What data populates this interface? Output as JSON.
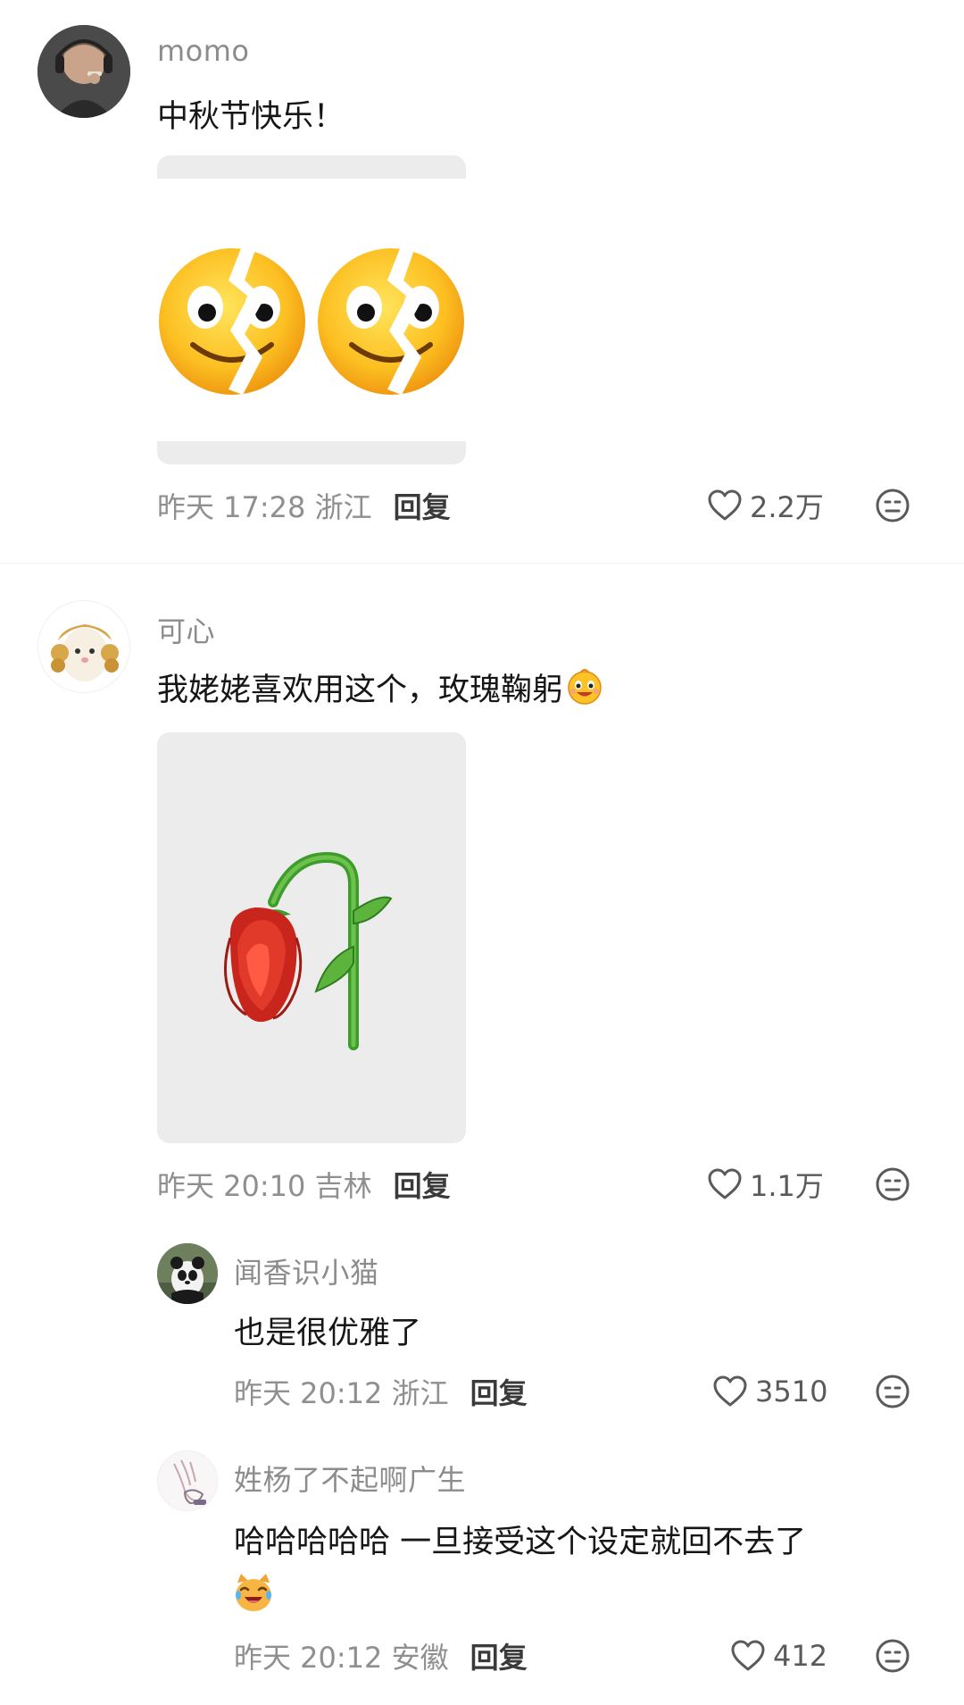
{
  "comments": [
    {
      "username": "momo",
      "text": "中秋节快乐！",
      "sticker_icon": "cracked-smiley-sticker",
      "time_location": "昨天 17:28 浙江",
      "reply_label": "回复",
      "likes": "2.2万"
    },
    {
      "username": "可心",
      "text": "我姥姥喜欢用这个，玫瑰鞠躬",
      "inline_emoji": "happy-emoji",
      "sticker_icon": "wilted-rose-sticker",
      "time_location": "昨天 20:10 吉林",
      "reply_label": "回复",
      "likes": "1.1万",
      "replies": [
        {
          "username": "闻香识小猫",
          "text": "也是很优雅了",
          "time_location": "昨天 20:12 浙江",
          "reply_label": "回复",
          "likes": "3510"
        },
        {
          "username": "姓杨了不起啊广生",
          "text": "哈哈哈哈哈 一旦接受这个设定就回不去了",
          "inline_emoji": "laughing-cat-emoji",
          "time_location": "昨天 20:12 安徽",
          "reply_label": "回复",
          "likes": "412"
        }
      ]
    }
  ],
  "colors": {
    "username": "#8c8c8c",
    "text": "#161616",
    "meta": "#8f8f8f",
    "reply": "#3a3a3a"
  }
}
